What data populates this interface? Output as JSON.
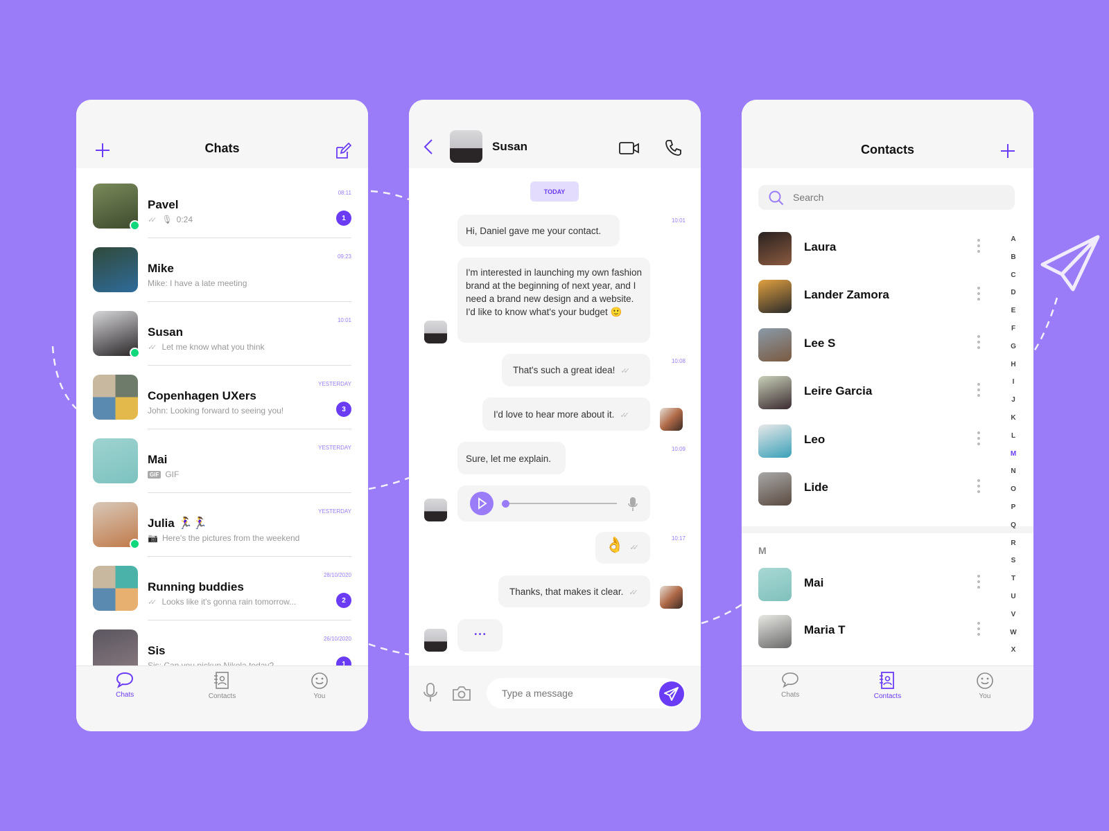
{
  "colors": {
    "background": "#9a7cf8",
    "accent": "#6a3cf5",
    "online": "#0fd77c"
  },
  "chats_screen": {
    "title": "Chats",
    "add_icon": "plus-icon",
    "compose_icon": "compose-icon",
    "items": [
      {
        "name": "Pavel",
        "preview": "0:24",
        "time": "08:11",
        "unread": "1",
        "online": true,
        "ticks": true,
        "prefix": "mic",
        "avatar": [
          "#7a8a5a",
          "#3d4a2e"
        ]
      },
      {
        "name": "Mike",
        "preview": "Mike: I have a late meeting",
        "time": "09:23",
        "unread": "",
        "online": false,
        "ticks": false,
        "prefix": "",
        "avatar": [
          "#304a3a",
          "#2f6b9a"
        ]
      },
      {
        "name": "Susan",
        "preview": "Let me know what you think",
        "time": "10:01",
        "unread": "",
        "online": true,
        "ticks": true,
        "prefix": "",
        "avatar": [
          "#d6d6d9",
          "#2a2628"
        ]
      },
      {
        "name": "Copenhagen UXers",
        "preview": "John: Looking forward to seeing you!",
        "time": "YESTERDAY",
        "unread": "3",
        "online": false,
        "ticks": false,
        "prefix": "",
        "group": true,
        "avatar": [
          "#6f7b6a",
          "#e2b94a"
        ]
      },
      {
        "name": "Mai",
        "preview": "GIF",
        "time": "YESTERDAY",
        "unread": "",
        "online": false,
        "ticks": false,
        "prefix": "gif",
        "avatar": [
          "#9fd3d0",
          "#7cc2bf"
        ]
      },
      {
        "name": "Julia 🏃‍♀️🏃‍♀️",
        "preview": "Here's the pictures from the weekend",
        "time": "YESTERDAY",
        "unread": "",
        "online": true,
        "ticks": false,
        "prefix": "camera",
        "avatar": [
          "#d8c8b8",
          "#c07a4a"
        ]
      },
      {
        "name": "Running buddies",
        "preview": "Looks like it's gonna rain tomorrow...",
        "time": "28/10/2020",
        "unread": "2",
        "online": false,
        "ticks": true,
        "prefix": "",
        "group": true,
        "avatar": [
          "#4ab2a8",
          "#e8b070"
        ]
      },
      {
        "name": "Sis",
        "preview": "Sis: Can you pickup Nikola today?",
        "time": "26/10/2020",
        "unread": "1",
        "online": false,
        "ticks": false,
        "prefix": "",
        "avatar": [
          "#5a5660",
          "#8a7a80"
        ]
      }
    ]
  },
  "conversation": {
    "contact_name": "Susan",
    "date_chip": "TODAY",
    "messages": [
      {
        "text": "Hi, Daniel gave me your contact.",
        "time": "10:01"
      },
      {
        "text": "I'm interested in launching my own fashion brand at the beginning of next year, and I need a brand new design and a website. I'd like to know what's your budget 🙂"
      },
      {
        "text": "That's such a great idea!",
        "time": "10:08"
      },
      {
        "text": "I'd love to hear more about it."
      },
      {
        "text": "Sure, let me explain.",
        "time": "10:09"
      },
      {
        "text": "👌",
        "time": "10:17"
      },
      {
        "text": "Thanks, that makes it clear."
      },
      {
        "text": "• • •"
      }
    ],
    "voice_progress": 0,
    "input_placeholder": "Type a message"
  },
  "contacts_screen": {
    "title": "Contacts",
    "search_placeholder": "Search",
    "contacts": [
      {
        "name": "Laura",
        "avatar": [
          "#2a2220",
          "#8a5a40"
        ]
      },
      {
        "name": "Lander Zamora",
        "avatar": [
          "#e0a040",
          "#2a2a2a"
        ]
      },
      {
        "name": "Lee S",
        "avatar": [
          "#8a9aa8",
          "#7a5a40"
        ]
      },
      {
        "name": "Leire Garcia",
        "avatar": [
          "#c8d0b8",
          "#3a2a30"
        ]
      },
      {
        "name": "Leo",
        "avatar": [
          "#e8e8e8",
          "#3aa0b8"
        ]
      },
      {
        "name": "Lide",
        "avatar": [
          "#a8a8a8",
          "#5a4a40"
        ]
      }
    ],
    "section": "M",
    "section_contacts": [
      {
        "name": "Mai",
        "avatar": [
          "#a8d8d4",
          "#80c0bc"
        ]
      },
      {
        "name": "Maria T",
        "avatar": [
          "#e8e8e4",
          "#6a6a6a"
        ]
      }
    ],
    "alphabet": [
      "A",
      "B",
      "C",
      "D",
      "E",
      "F",
      "G",
      "H",
      "I",
      "J",
      "K",
      "L",
      "M",
      "N",
      "O",
      "P",
      "Q",
      "R",
      "S",
      "T",
      "U",
      "V",
      "W",
      "X"
    ],
    "active_letter": "M"
  },
  "nav": {
    "chats": "Chats",
    "contacts": "Contacts",
    "you": "You"
  }
}
